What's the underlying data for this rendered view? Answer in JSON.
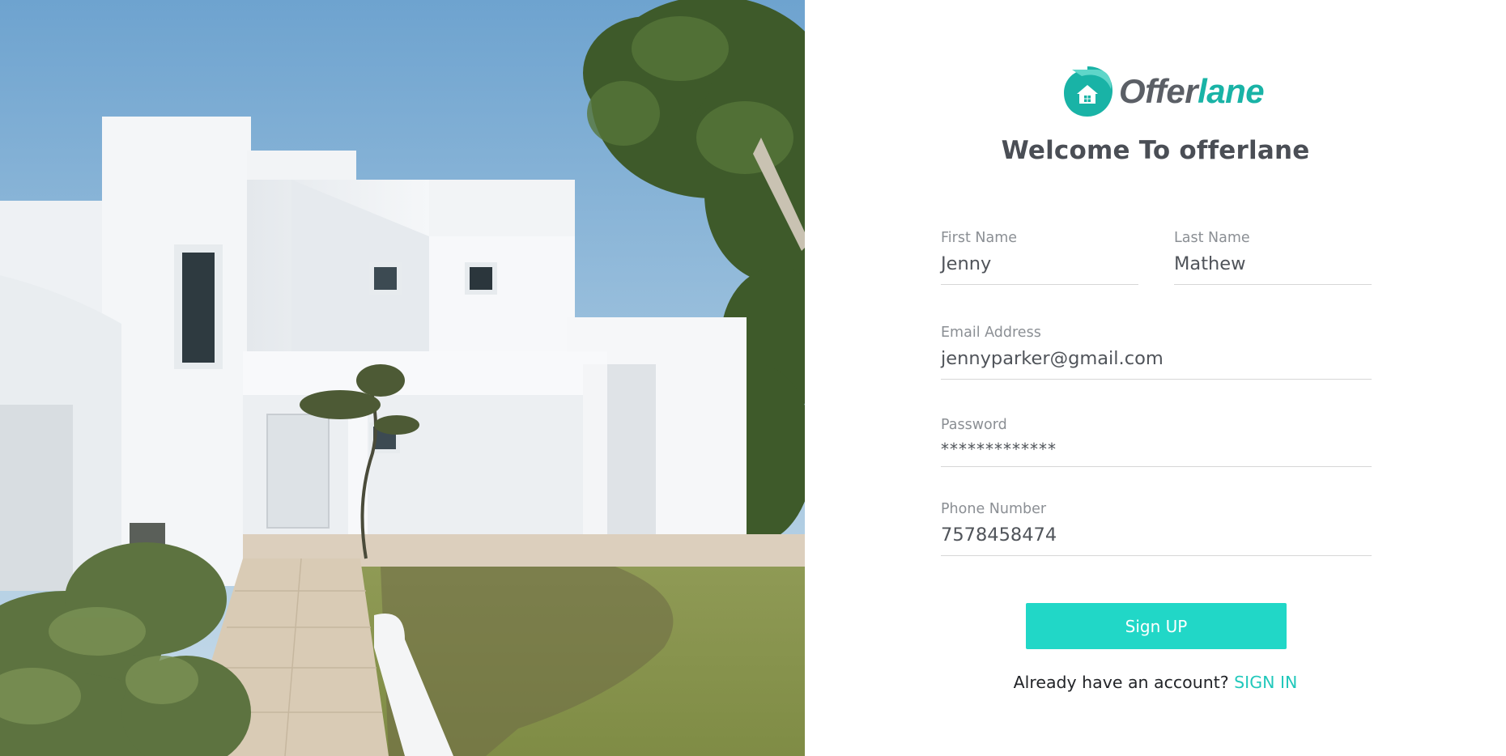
{
  "brand": {
    "name_part1": "Offer",
    "name_part2": "lane",
    "accent_color": "#19b3a6",
    "icon": "house-logo-icon"
  },
  "hero": {
    "description_icon": "house-photo"
  },
  "welcome_title": "Welcome To offerlane",
  "form": {
    "first_name": {
      "label": "First Name",
      "value": "Jenny"
    },
    "last_name": {
      "label": "Last Name",
      "value": "Mathew"
    },
    "email": {
      "label": "Email Address",
      "value": "jennyparker@gmail.com"
    },
    "password": {
      "label": "Password",
      "value": "*************"
    },
    "phone": {
      "label": "Phone Number",
      "value": "7578458474"
    }
  },
  "signup_button": {
    "label": "Sign UP",
    "color": "#21d7c7"
  },
  "signin": {
    "prompt": "Already have an account?",
    "link_label": "SIGN IN"
  }
}
